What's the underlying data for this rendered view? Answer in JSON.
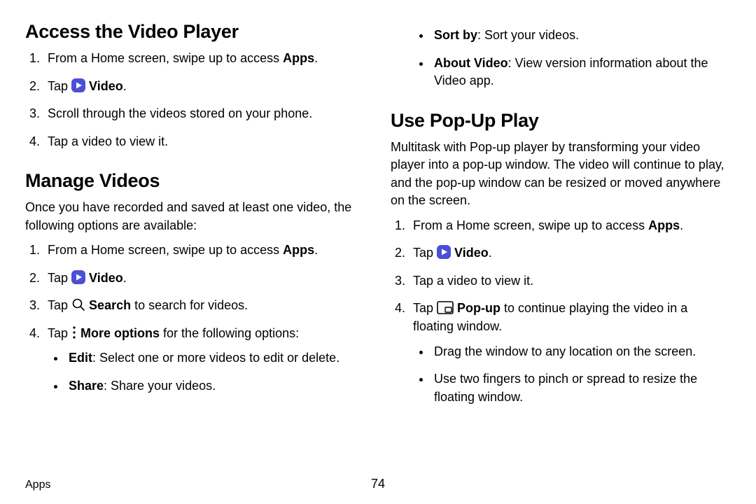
{
  "footer": {
    "section": "Apps",
    "pagenum": "74"
  },
  "left": {
    "h_access": "Access the Video Player",
    "access": {
      "s1_a": "From a Home screen, swipe up to access ",
      "s1_b": "Apps",
      "s1_c": ".",
      "s2_a": "Tap ",
      "s2_b": "Video",
      "s2_c": ".",
      "s3": "Scroll through the videos stored on your phone.",
      "s4": "Tap a video to view it."
    },
    "h_manage": "Manage Videos",
    "manage_intro": "Once you have recorded and saved at least one video, the following options are available:",
    "manage": {
      "s1_a": "From a Home screen, swipe up to access ",
      "s1_b": "Apps",
      "s1_c": ".",
      "s2_a": "Tap ",
      "s2_b": "Video",
      "s2_c": ".",
      "s3_a": "Tap ",
      "s3_b": "Search",
      "s3_c": " to search for videos.",
      "s4_a": "Tap ",
      "s4_b": "More options",
      "s4_c": " for the following options:",
      "opt_edit_a": "Edit",
      "opt_edit_b": ": Select one or more videos to edit or delete.",
      "opt_share_a": "Share",
      "opt_share_b": ": Share your videos."
    }
  },
  "right": {
    "opt_sort_a": "Sort by",
    "opt_sort_b": ": Sort your videos.",
    "opt_about_a": "About Video",
    "opt_about_b": ": View version information about the Video app.",
    "h_popup": "Use Pop-Up Play",
    "popup_intro": "Multitask with Pop-up player by transforming your video player into a pop-up window. The video will continue to play, and the pop-up window can be resized or moved anywhere on the screen.",
    "popup": {
      "s1_a": "From a Home screen, swipe up to access ",
      "s1_b": "Apps",
      "s1_c": ".",
      "s2_a": "Tap ",
      "s2_b": "Video",
      "s2_c": ".",
      "s3": "Tap a video to view it.",
      "s4_a": "Tap ",
      "s4_b": "Pop-up",
      "s4_c": " to continue playing the video in a floating window.",
      "sub_drag": "Drag the window to any location on the screen.",
      "sub_pinch": "Use two fingers to pinch or spread to resize the floating window."
    }
  }
}
